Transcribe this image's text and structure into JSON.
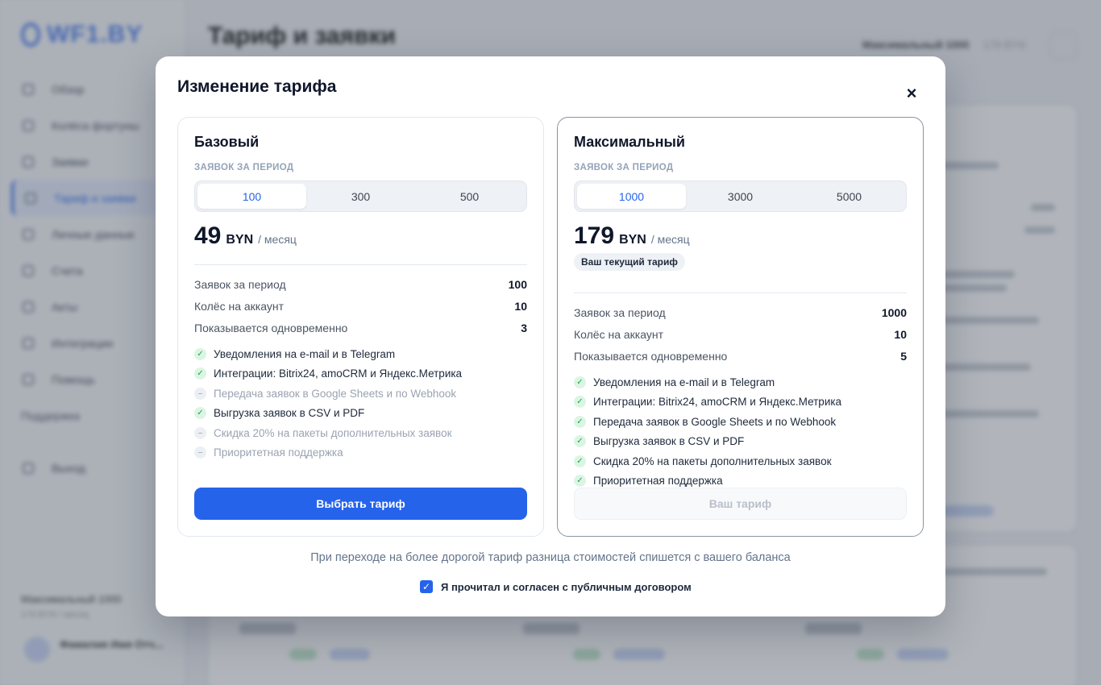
{
  "background": {
    "logo": "WF1.BY",
    "page_title": "Тариф и заявки",
    "topbar_plan": "Максимальный 1000",
    "topbar_meta": "179 BYN",
    "nav": [
      "Обзор",
      "Колёса фортуны",
      "Заявки",
      "Тариф и заявки",
      "Личные данные",
      "Счета",
      "Акты",
      "Интеграции",
      "Помощь"
    ],
    "nav_section": "Поддержка",
    "nav_exit": "Выход",
    "sidebar_plan": "Максимальный 1000",
    "sidebar_plan_meta": "179 BYN / месяц",
    "user_name": "Фамилия Имя Отч..."
  },
  "modal": {
    "title": "Изменение тарифа",
    "close": "×",
    "note": "При переходе на более дорогой тариф разница стоимостей спишется с вашего баланса",
    "agree_label": "Я прочитал и согласен с публичным договором",
    "agree_checked": true
  },
  "plans": [
    {
      "name": "Базовый",
      "period_label": "ЗАЯВОК ЗА ПЕРИОД",
      "options": [
        "100",
        "300",
        "500"
      ],
      "selected": "100",
      "price": "49",
      "currency": "BYN",
      "per": "/ месяц",
      "stats": [
        {
          "label": "Заявок за период",
          "value": "100"
        },
        {
          "label": "Колёс на аккаунт",
          "value": "10"
        },
        {
          "label": "Показывается одновременно",
          "value": "3"
        }
      ],
      "features": [
        {
          "text": "Уведомления на e-mail и в Telegram",
          "enabled": true
        },
        {
          "text": "Интеграции: Bitrix24, amoCRM и Яндекс.Метрика",
          "enabled": true
        },
        {
          "text": "Передача заявок в Google Sheets и по Webhook",
          "enabled": false
        },
        {
          "text": "Выгрузка заявок в CSV и PDF",
          "enabled": true
        },
        {
          "text": "Скидка 20% на пакеты дополнительных заявок",
          "enabled": false
        },
        {
          "text": "Приоритетная поддержка",
          "enabled": false
        }
      ],
      "cta": "Выбрать тариф"
    },
    {
      "name": "Максимальный",
      "period_label": "ЗАЯВОК ЗА ПЕРИОД",
      "options": [
        "1000",
        "3000",
        "5000"
      ],
      "selected": "1000",
      "price": "179",
      "currency": "BYN",
      "per": "/ месяц",
      "current_badge": "Ваш текущий тариф",
      "stats": [
        {
          "label": "Заявок за период",
          "value": "1000"
        },
        {
          "label": "Колёс на аккаунт",
          "value": "10"
        },
        {
          "label": "Показывается одновременно",
          "value": "5"
        }
      ],
      "features": [
        {
          "text": "Уведомления на e-mail и в Telegram",
          "enabled": true
        },
        {
          "text": "Интеграции: Bitrix24, amoCRM и Яндекс.Метрика",
          "enabled": true
        },
        {
          "text": "Передача заявок в Google Sheets и по Webhook",
          "enabled": true
        },
        {
          "text": "Выгрузка заявок в CSV и PDF",
          "enabled": true
        },
        {
          "text": "Скидка 20% на пакеты дополнительных заявок",
          "enabled": true
        },
        {
          "text": "Приоритетная поддержка",
          "enabled": true
        }
      ],
      "cta": "Ваш тариф"
    }
  ],
  "colors": {
    "accent": "#2563eb",
    "check": "#16a34a",
    "muted": "#94a3b8"
  }
}
